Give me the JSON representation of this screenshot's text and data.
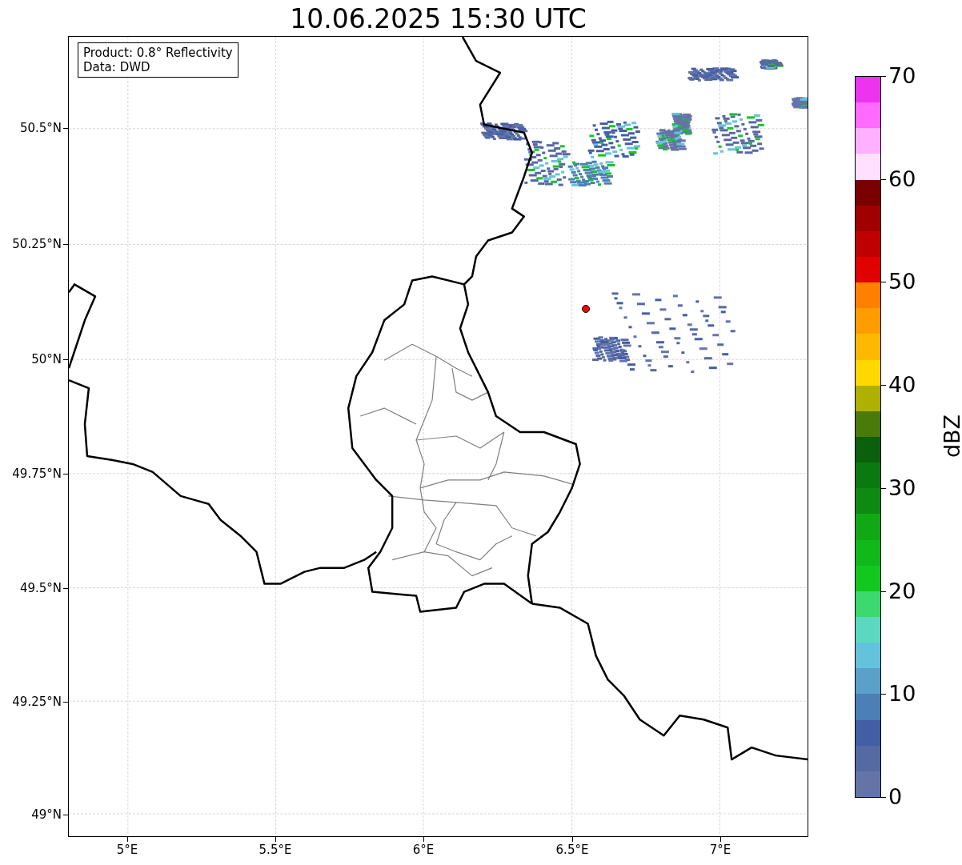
{
  "title": "10.06.2025 15:30 UTC",
  "legend": {
    "lines": [
      "Product: 0.8° Reflectivity",
      "Data: DWD"
    ]
  },
  "map": {
    "y_ticks": [
      "50.5°N",
      "50.25°N",
      "50°N",
      "49.75°N",
      "49.5°N",
      "49.25°N",
      "49°N"
    ],
    "x_ticks": [
      "5°E",
      "5.5°E",
      "6°E",
      "6.5°E",
      "7°E"
    ]
  },
  "colorbar": {
    "label": "dBZ",
    "ticks": [
      "70",
      "60",
      "50",
      "40",
      "30",
      "20",
      "10",
      "0"
    ],
    "bands": [
      {
        "color": "#ee33ee"
      },
      {
        "color": "#ff6aff"
      },
      {
        "color": "#ffb0ff"
      },
      {
        "color": "#ffe0ff"
      },
      {
        "color": "#7a0000"
      },
      {
        "color": "#a00000"
      },
      {
        "color": "#c00000"
      },
      {
        "color": "#e00000"
      },
      {
        "color": "#ff8000"
      },
      {
        "color": "#ff9c00"
      },
      {
        "color": "#ffb800"
      },
      {
        "color": "#ffd800"
      },
      {
        "color": "#b0b000"
      },
      {
        "color": "#4a7a0a"
      },
      {
        "color": "#0a600c"
      },
      {
        "color": "#0a7a10"
      },
      {
        "color": "#0e8a12"
      },
      {
        "color": "#10a814"
      },
      {
        "color": "#10b81a"
      },
      {
        "color": "#12c81e"
      },
      {
        "color": "#3cd870"
      },
      {
        "color": "#5cd8c0"
      },
      {
        "color": "#64c3dc"
      },
      {
        "color": "#5aa0c8"
      },
      {
        "color": "#4b7fb5"
      },
      {
        "color": "#445ea5"
      },
      {
        "color": "#5569a2"
      },
      {
        "color": "#6574a8"
      }
    ]
  }
}
